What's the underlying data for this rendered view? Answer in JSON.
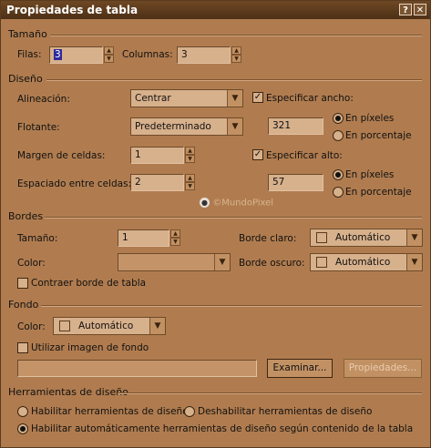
{
  "window": {
    "title": "Propiedades de tabla",
    "help_label": "?",
    "close_label": "✕"
  },
  "size": {
    "section": "Tamaño",
    "rows_label": "Filas:",
    "rows_value": "3",
    "cols_label": "Columnas:",
    "cols_value": "3"
  },
  "design": {
    "section": "Diseño",
    "align_label": "Alineación:",
    "align_value": "Centrar",
    "float_label": "Flotante:",
    "float_value": "Predeterminado",
    "padding_label": "Margen de celdas:",
    "padding_value": "1",
    "spacing_label": "Espaciado entre celdas:",
    "spacing_value": "2",
    "width_check_label": "Especificar ancho:",
    "width_value": "321",
    "width_px_label": "En píxeles",
    "width_pct_label": "En porcentaje",
    "height_check_label": "Especificar alto:",
    "height_value": "57",
    "height_px_label": "En píxeles",
    "height_pct_label": "En porcentaje",
    "watermark": "©MundoPixel"
  },
  "borders": {
    "section": "Bordes",
    "size_label": "Tamaño:",
    "size_value": "1",
    "color_label": "Color:",
    "light_label": "Borde claro:",
    "light_value": "Automático",
    "dark_label": "Borde oscuro:",
    "dark_value": "Automático",
    "collapse_label": "Contraer borde de tabla"
  },
  "background": {
    "section": "Fondo",
    "color_label": "Color:",
    "color_value": "Automático",
    "image_label": "Utilizar imagen de fondo",
    "browse_label": "Examinar...",
    "properties_label": "Propiedades..."
  },
  "tools": {
    "section": "Herramientas de diseño",
    "enable_label": "Habilitar herramientas de diseño",
    "disable_label": "Deshabilitar herramientas de diseño",
    "auto_label": "Habilitar automáticamente herramientas de diseño según contenido de la tabla"
  },
  "colors": {
    "accent_selection": "#2f2a9a",
    "background": "#b07c4f"
  }
}
